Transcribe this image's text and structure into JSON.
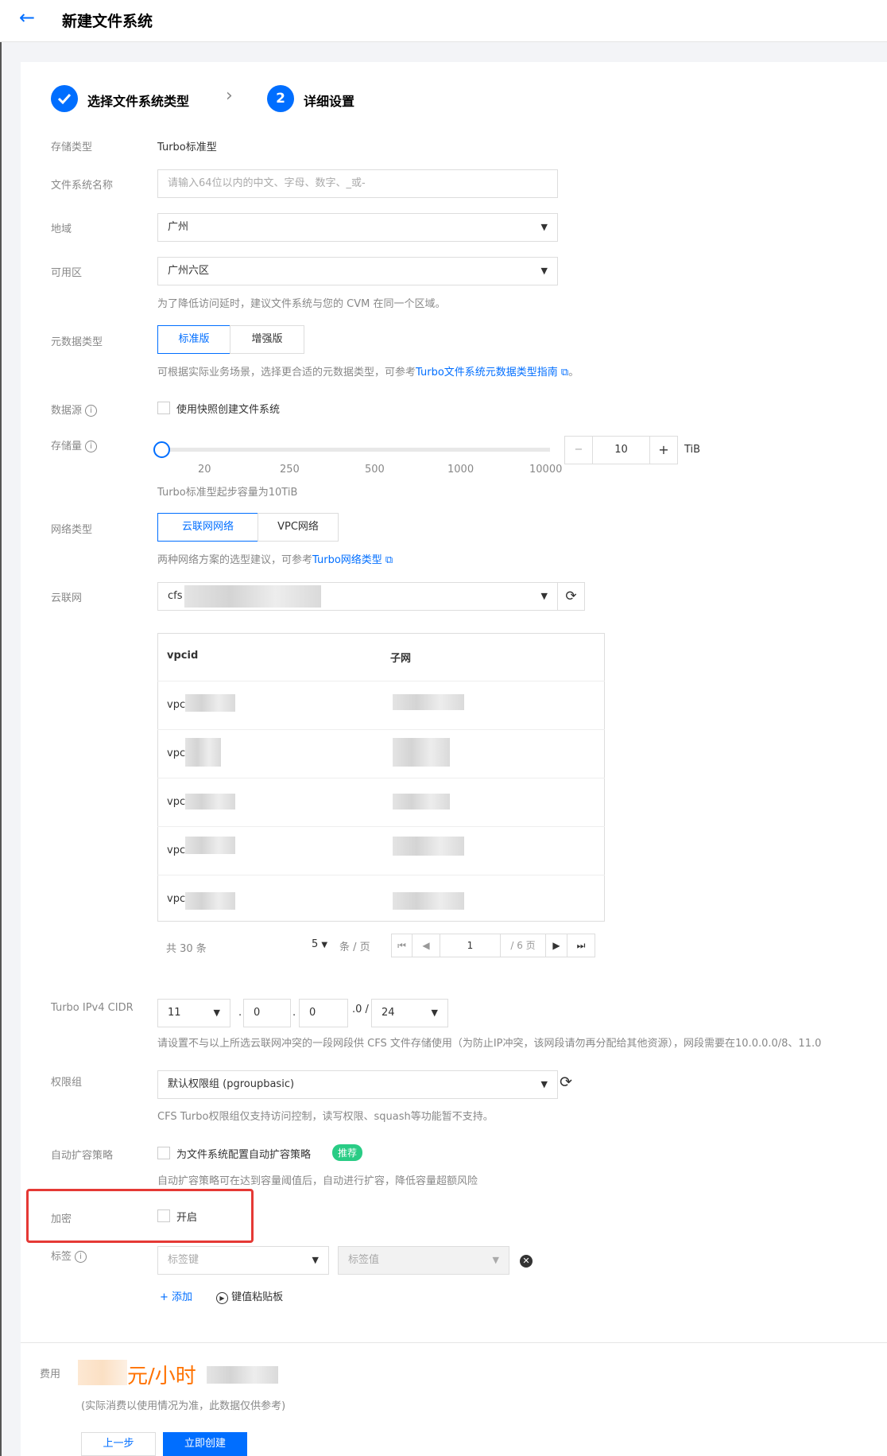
{
  "header": {
    "back_icon": "arrow-left-icon",
    "title": "新建文件系统"
  },
  "steps": [
    {
      "label": "选择文件系统类型",
      "state": "done"
    },
    {
      "number": "2",
      "label": "详细设置",
      "state": "active"
    }
  ],
  "form": {
    "storage_type": {
      "label": "存储类型",
      "value": "Turbo标准型"
    },
    "fs_name": {
      "label": "文件系统名称",
      "placeholder": "请输入64位以内的中文、字母、数字、_或-"
    },
    "region": {
      "label": "地域",
      "value": "广州"
    },
    "zone": {
      "label": "可用区",
      "value": "广州六区",
      "hint": "为了降低访问延时，建议文件系统与您的 CVM 在同一个区域。"
    },
    "metadata_type": {
      "label": "元数据类型",
      "options": [
        "标准版",
        "增强版"
      ],
      "selected": "标准版",
      "hint_prefix": "可根据实际业务场景，选择更合适的元数据类型，可参考",
      "hint_link": "Turbo文件系统元数据类型指南",
      "hint_suffix": "。"
    },
    "data_source": {
      "label": "数据源",
      "checkbox_label": "使用快照创建文件系统"
    },
    "capacity": {
      "label": "存储量",
      "ticks": [
        "20",
        "250",
        "500",
        "1000",
        "10000"
      ],
      "minus": "−",
      "value": "10",
      "plus": "+",
      "unit": "TiB",
      "hint": "Turbo标准型起步容量为10TiB"
    },
    "network_type": {
      "label": "网络类型",
      "options": [
        "云联网网络",
        "VPC网络"
      ],
      "selected": "云联网网络",
      "hint_prefix": "两种网络方案的选型建议，可参考",
      "hint_link": "Turbo网络类型"
    },
    "ccn": {
      "label": "云联网",
      "value": "cfs",
      "table": {
        "headers": [
          "vpcid",
          "子网"
        ],
        "rows": [
          {
            "vpcid": "vpc"
          },
          {
            "vpcid": "vpc"
          },
          {
            "vpcid": "vpc"
          },
          {
            "vpcid": "vpc"
          },
          {
            "vpcid": "vpc"
          }
        ]
      },
      "pagination": {
        "total": "共 30 条",
        "page_size": "5",
        "page_size_unit": "条 / 页",
        "current_page": "1",
        "total_pages": "/ 6 页"
      }
    },
    "cidr": {
      "label": "Turbo IPv4 CIDR",
      "octet1": "11",
      "octet2": "0",
      "octet3": "0",
      "octet4": ".0 /",
      "mask": "24",
      "hint": "请设置不与以上所选云联网冲突的一段网段供 CFS 文件存储使用（为防止IP冲突，该网段请勿再分配给其他资源），网段需要在10.0.0.0/8、11.0"
    },
    "permission_group": {
      "label": "权限组",
      "value": "默认权限组 (pgroupbasic)",
      "hint": "CFS Turbo权限组仅支持访问控制，读写权限、squash等功能暂不支持。"
    },
    "auto_scale": {
      "label": "自动扩容策略",
      "checkbox_label": "为文件系统配置自动扩容策略",
      "badge": "推荐",
      "hint": "自动扩容策略可在达到容量阈值后，自动进行扩容，降低容量超额风险"
    },
    "encryption": {
      "label": "加密",
      "checkbox_label": "开启"
    },
    "tags": {
      "label": "标签",
      "key_placeholder": "标签键",
      "value_placeholder": "标签值",
      "add_label": "添加",
      "paste_label": "键值粘贴板"
    }
  },
  "footer": {
    "cost_label": "费用",
    "cost_unit": "元/小时",
    "cost_note": "(实际消费以使用情况为准，此数据仅供参考)",
    "prev_button": "上一步",
    "create_button": "立即创建"
  },
  "colors": {
    "primary": "#006eff",
    "accent_orange": "#ff7200",
    "success_green": "#29cc85",
    "highlight_red": "#e53935"
  }
}
